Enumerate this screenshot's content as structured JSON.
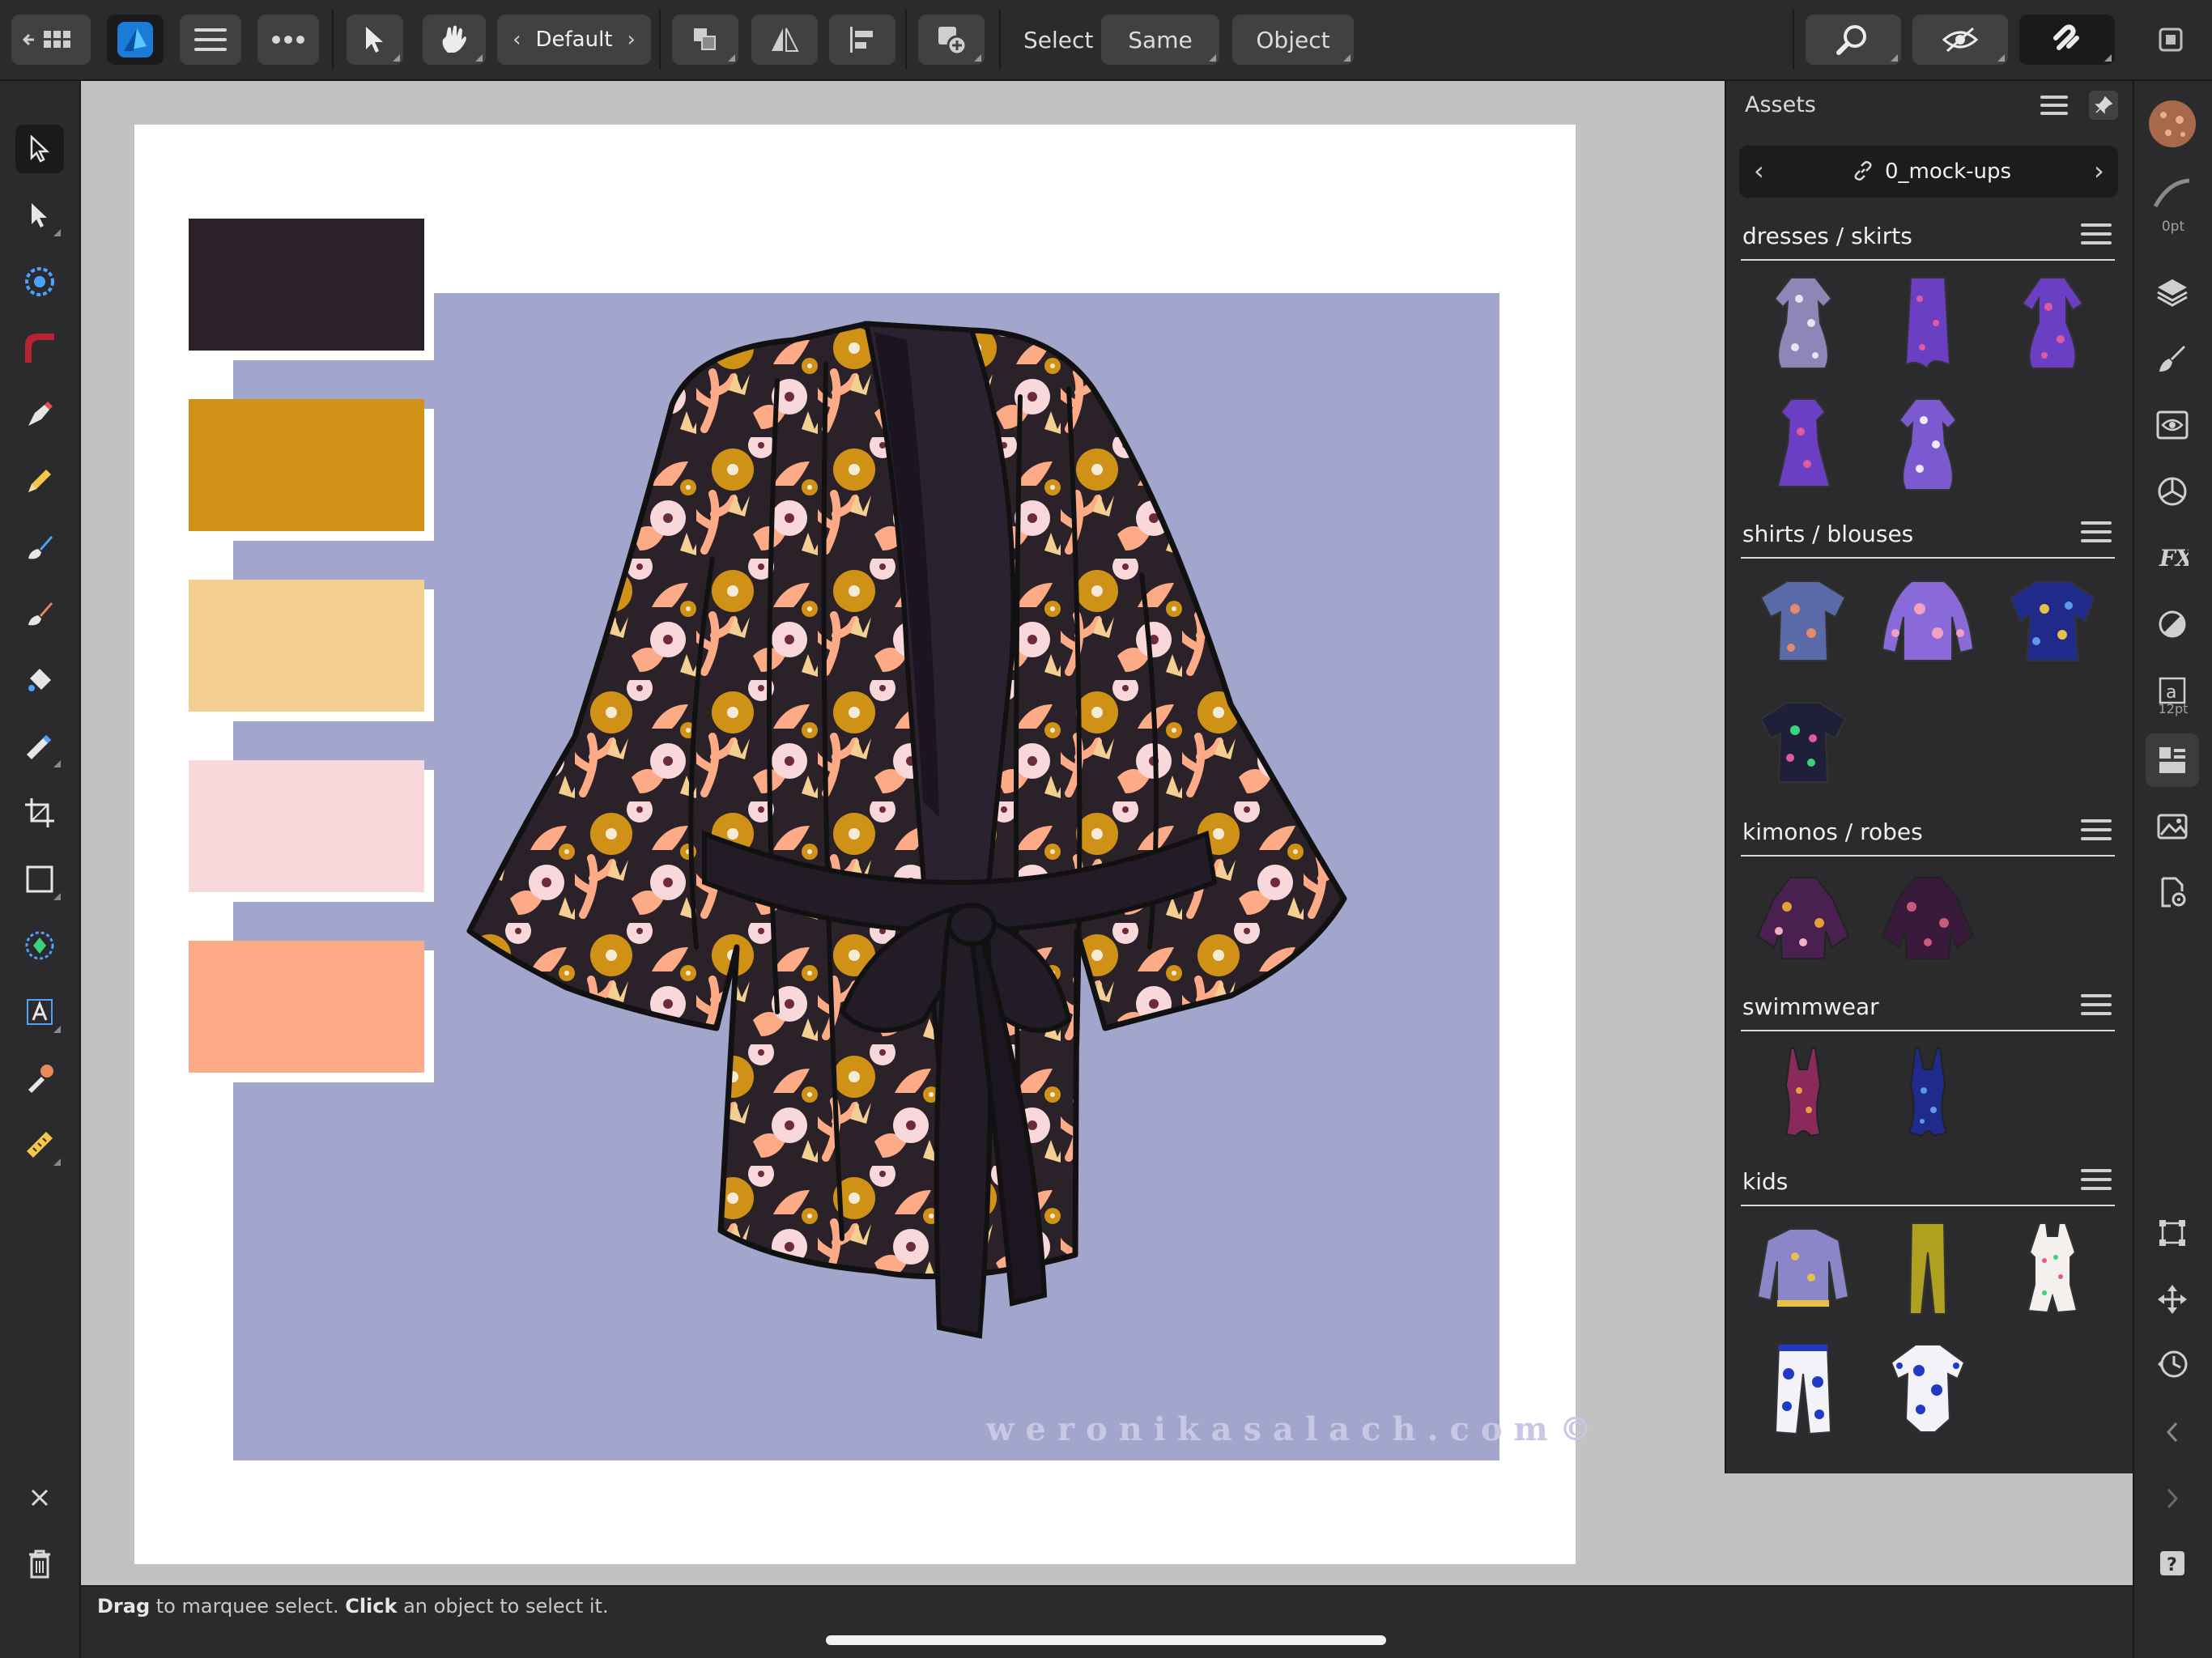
{
  "toolbar": {
    "persona_preset": "Default",
    "select_label": "Select",
    "same_label": "Same",
    "object_label": "Object"
  },
  "icons": {
    "back_grid": "back-grid-icon",
    "affinity": "affinity-designer-logo",
    "menu": "hamburger-menu-icon",
    "more": "ellipsis-icon",
    "move": "move-tool-icon",
    "gesture": "hand-gesture-icon",
    "arrange": "arrange-icon",
    "flip": "flip-icon",
    "align": "align-icon",
    "add_object": "add-object-icon",
    "zoom": "zoom-icon",
    "view_mode": "view-mode-icon",
    "snapping": "snapping-magnet-icon",
    "window": "window-mode-icon"
  },
  "palette": {
    "colors": [
      "#2b2229",
      "#cf9216",
      "#f4cf92",
      "#f9d8dc",
      "#fdab86"
    ]
  },
  "canvas": {
    "backdrop_color": "#a2a6cc",
    "watermark": "weronikasalach.com©"
  },
  "assets": {
    "title": "Assets",
    "source": "0_mock-ups",
    "categories": [
      {
        "title": "dresses / skirts",
        "count": 5
      },
      {
        "title": "shirts / blouses",
        "count": 4
      },
      {
        "title": "kimonos / robes",
        "count": 2
      },
      {
        "title": "swimmwear",
        "count": 2
      },
      {
        "title": "kids",
        "count": 5
      }
    ]
  },
  "studio": {
    "stroke_width": "0pt",
    "font_size": "12pt"
  },
  "status": {
    "hint_bold1": "Drag",
    "hint_text1": " to marquee select. ",
    "hint_bold2": "Click",
    "hint_text2": " an object to select it."
  }
}
